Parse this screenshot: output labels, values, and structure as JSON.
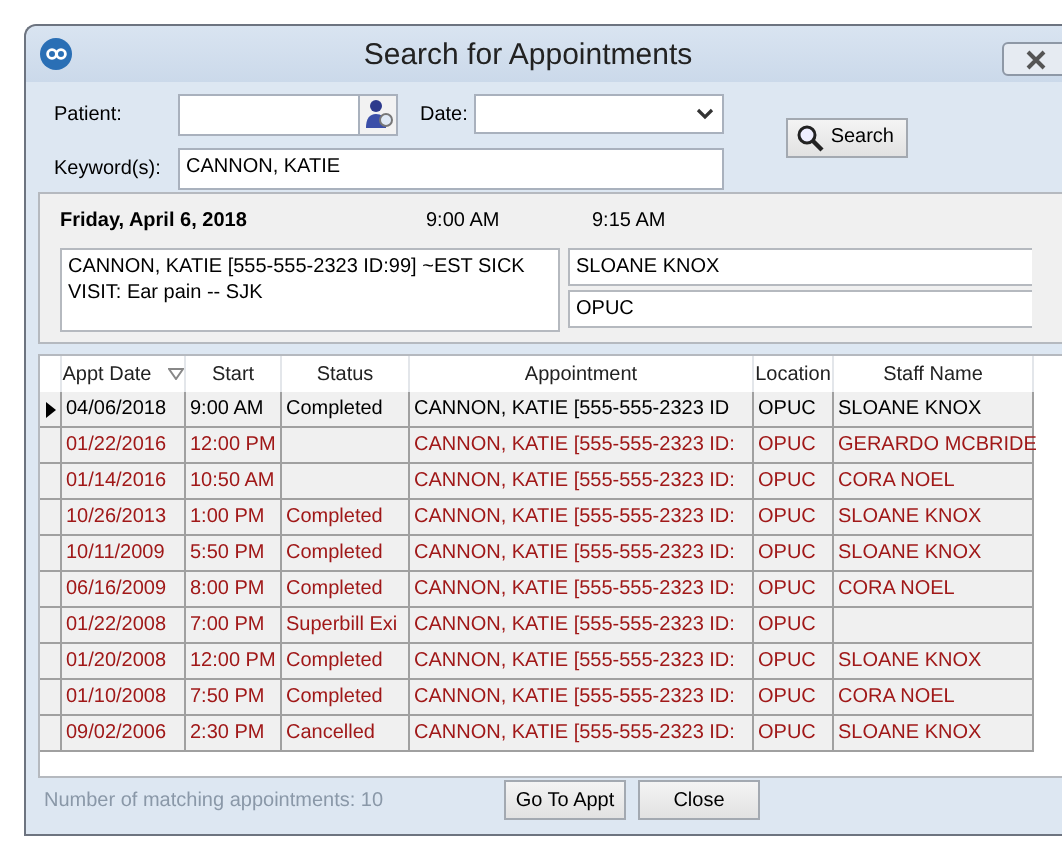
{
  "window": {
    "title": "Search for Appointments"
  },
  "form": {
    "patient_label": "Patient:",
    "date_label": "Date:",
    "keyword_label": "Keyword(s):",
    "keyword_value": "CANNON, KATIE",
    "search_button": "Search"
  },
  "detail": {
    "date": "Friday, April 6, 2018",
    "start": "9:00 AM",
    "end": "9:15 AM",
    "description": "CANNON, KATIE  [555-555-2323 ID:99] ~EST SICK VISIT: Ear pain -- SJK",
    "staff": "SLOANE KNOX",
    "location": "OPUC"
  },
  "table": {
    "columns": [
      "Appt Date",
      "Start",
      "Status",
      "Appointment",
      "Location",
      "Staff Name"
    ],
    "rows": [
      {
        "selected": true,
        "past": false,
        "cells": [
          "04/06/2018",
          "9:00 AM",
          "Completed",
          "CANNON, KATIE  [555-555-2323 ID",
          "OPUC",
          "SLOANE KNOX"
        ]
      },
      {
        "selected": false,
        "past": true,
        "cells": [
          "01/22/2016",
          "12:00 PM",
          "",
          "CANNON, KATIE [555-555-2323 ID:",
          "OPUC",
          "GERARDO MCBRIDE"
        ]
      },
      {
        "selected": false,
        "past": true,
        "cells": [
          "01/14/2016",
          "10:50 AM",
          "",
          "CANNON, KATIE [555-555-2323 ID:",
          "OPUC",
          "CORA NOEL"
        ]
      },
      {
        "selected": false,
        "past": true,
        "cells": [
          "10/26/2013",
          "1:00 PM",
          "Completed",
          "CANNON, KATIE [555-555-2323 ID:",
          "OPUC",
          "SLOANE KNOX"
        ]
      },
      {
        "selected": false,
        "past": true,
        "cells": [
          "10/11/2009",
          "5:50 PM",
          "Completed",
          "CANNON, KATIE [555-555-2323 ID:",
          "OPUC",
          "SLOANE KNOX"
        ]
      },
      {
        "selected": false,
        "past": true,
        "cells": [
          "06/16/2009",
          "8:00 PM",
          "Completed",
          "CANNON, KATIE [555-555-2323 ID:",
          "OPUC",
          "CORA NOEL"
        ]
      },
      {
        "selected": false,
        "past": true,
        "cells": [
          "01/22/2008",
          "7:00 PM",
          "Superbill Exi",
          "CANNON, KATIE [555-555-2323 ID:",
          "OPUC",
          ""
        ]
      },
      {
        "selected": false,
        "past": true,
        "cells": [
          "01/20/2008",
          "12:00 PM",
          "Completed",
          "CANNON, KATIE [555-555-2323 ID:",
          "OPUC",
          "SLOANE KNOX"
        ]
      },
      {
        "selected": false,
        "past": true,
        "cells": [
          "01/10/2008",
          "7:50 PM",
          "Completed",
          "CANNON, KATIE [555-555-2323 ID:",
          "OPUC",
          "CORA NOEL"
        ]
      },
      {
        "selected": false,
        "past": true,
        "cells": [
          "09/02/2006",
          "2:30 PM",
          "Cancelled",
          "CANNON, KATIE [555-555-2323 ID:",
          "OPUC",
          "SLOANE KNOX"
        ]
      }
    ]
  },
  "footer": {
    "count": "Number of matching appointments: 10",
    "buttons": [
      "Go To Appt",
      "Close"
    ]
  }
}
